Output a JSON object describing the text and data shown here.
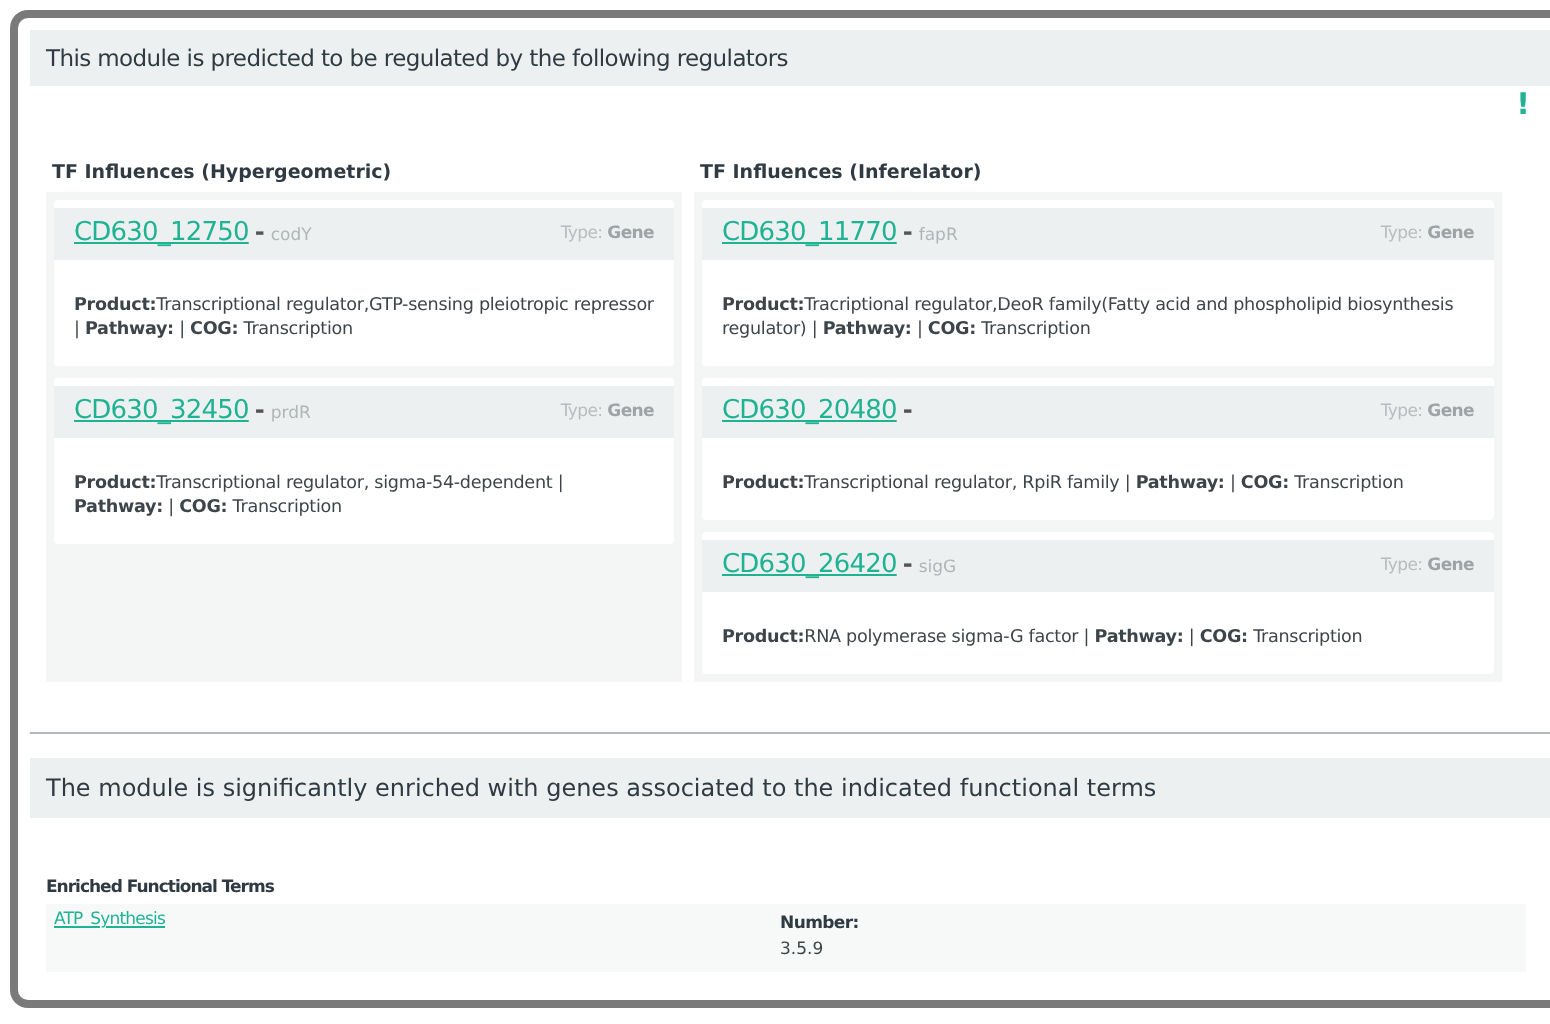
{
  "regulators_panel": {
    "header": "This module is predicted to be regulated by the following regulators",
    "alert": "!",
    "columns": [
      {
        "title": "TF Influences (Hypergeometric)",
        "genes": [
          {
            "id": "CD630_12750",
            "separator": "-",
            "name": "codY",
            "type": "Type: **Gene**",
            "description": "**Product:**Transcriptional regulator,GTP-sensing pleiotropic repressor | **Pathway:** | **COG:** Transcription"
          },
          {
            "id": "CD630_32450",
            "separator": "-",
            "name": "prdR",
            "type": "Type: **Gene**",
            "description": "**Product:**Transcriptional regulator, sigma-54-dependent | **Pathway:** | **COG:** Transcription"
          }
        ]
      },
      {
        "title": "TF Influences (Inferelator)",
        "genes": [
          {
            "id": "CD630_11770",
            "separator": "-",
            "name": "fapR",
            "type": "Type: **Gene**",
            "description": "**Product:**Tracriptional regulator,DeoR family(Fatty acid and phospholipid biosynthesis regulator) | **Pathway:** | **COG:** Transcription"
          },
          {
            "id": "CD630_20480",
            "separator": "-",
            "type": "Type: **Gene**",
            "description": "**Product:**Transcriptional regulator, RpiR family | **Pathway:** | **COG:** Transcription"
          },
          {
            "id": "CD630_26420",
            "separator": "-",
            "name": "sigG",
            "type": "Type: **Gene**",
            "description": "**Product:**RNA polymerase sigma-G factor | **Pathway:** | **COG:** Transcription"
          }
        ]
      }
    ]
  },
  "functional_panel": {
    "header": "The module is significantly enriched with genes associated to the indicated functional terms",
    "table_title": "Enriched Functional Terms",
    "rows": [
      {
        "term": "ATP_Synthesis",
        "number_label": "Number:",
        "number": "3.5.9"
      }
    ]
  }
}
